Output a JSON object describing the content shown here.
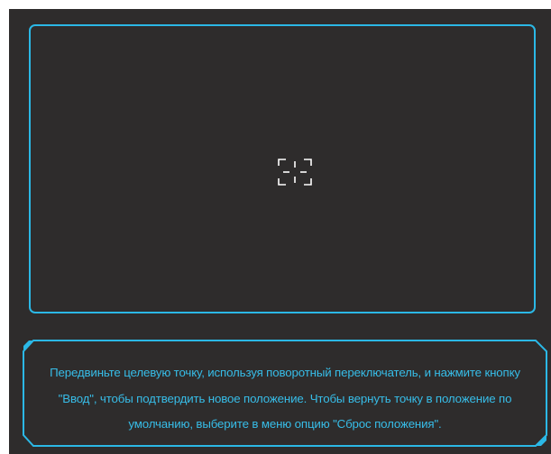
{
  "icons": {
    "target_point": "target-crosshair-icon"
  },
  "colors": {
    "background": "#2e2c2c",
    "accent": "#2bb8e6",
    "text": "#37bde8",
    "icon": "#ffffff"
  },
  "info_panel": {
    "message": "Передвиньте целевую точку, используя поворотный переключатель, и нажмите кнопку \"Ввод\", чтобы подтвердить новое положение. Чтобы вернуть точку в положение по умолчанию, выберите в меню опцию \"Сброс положения\"."
  }
}
